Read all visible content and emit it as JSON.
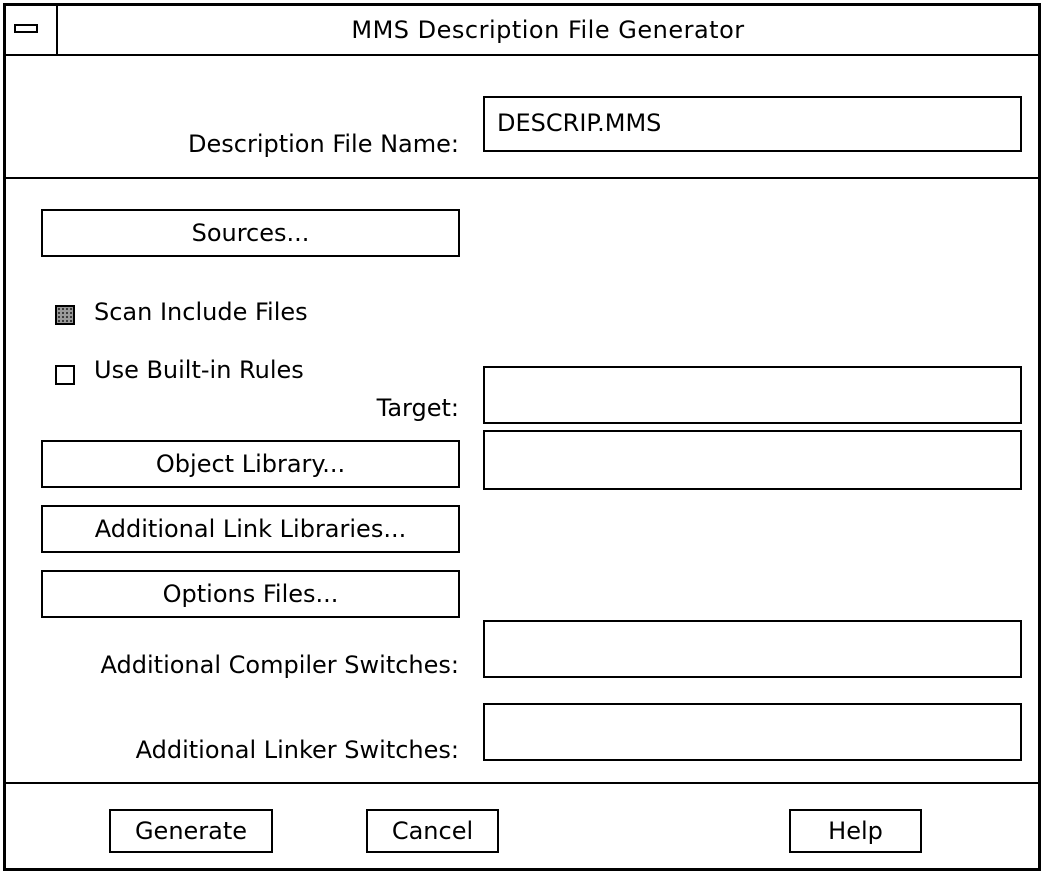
{
  "window": {
    "title": "MMS Description File Generator"
  },
  "description_file": {
    "label": "Description File Name:",
    "value": "DESCRIP.MMS"
  },
  "sources_button": "Sources...",
  "checkboxes": [
    {
      "label": "Scan Include Files",
      "checked": true
    },
    {
      "label": "Use Built-in Rules",
      "checked": false
    }
  ],
  "target": {
    "label": "Target:",
    "value": ""
  },
  "object_library": {
    "button": "Object Library...",
    "value": ""
  },
  "additional_link_libraries_button": "Additional Link Libraries...",
  "options_files_button": "Options Files...",
  "compiler_switches": {
    "label": "Additional Compiler Switches:",
    "value": ""
  },
  "linker_switches": {
    "label": "Additional Linker Switches:",
    "value": ""
  },
  "footer": {
    "generate": "Generate",
    "cancel": "Cancel",
    "help": "Help"
  }
}
